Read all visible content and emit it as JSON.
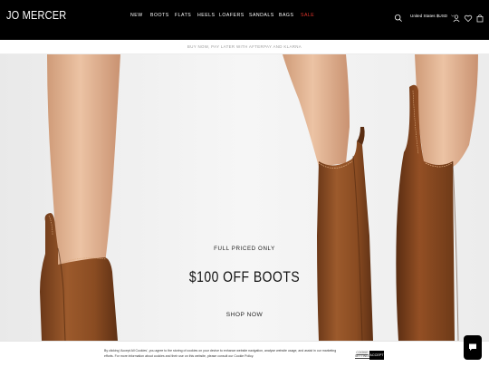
{
  "header": {
    "logo": "JO MERCER",
    "nav": [
      {
        "label": "NEW",
        "sale": false
      },
      {
        "label": "BOOTS",
        "sale": false
      },
      {
        "label": "FLATS",
        "sale": false
      },
      {
        "label": "HEELS",
        "sale": false
      },
      {
        "label": "LOAFERS",
        "sale": false
      },
      {
        "label": "SANDALS",
        "sale": false
      },
      {
        "label": "BAGS",
        "sale": false
      },
      {
        "label": "SALE",
        "sale": true
      }
    ],
    "currency": "United States $USD",
    "icons": [
      "search-icon",
      "chevron-down-icon",
      "account-icon",
      "wishlist-icon",
      "bag-icon"
    ]
  },
  "announcement": "BUY NOW, PAY LATER WITH AFTERPAY AND KLARNA",
  "hero": {
    "eyebrow": "FULL PRICED ONLY",
    "title": "$100 OFF BOOTS",
    "cta": "SHOP NOW"
  },
  "cookie": {
    "text": "By clicking 'Accept All Cookies', you agree to the storing of cookies on your device to enhance website navigation, analyse website usage, and assist in our marketing efforts. For more information about cookies and their use on this website, please consult our Cookie Policy.",
    "preferences": "COOKIE SETTINGS",
    "accept": "ACCEPT"
  },
  "chat": {
    "icon": "chat-icon"
  },
  "colors": {
    "header_bg": "#000000",
    "sale": "#e0342b",
    "boot_leather": "#8a4e26",
    "skin": "#e3b898"
  }
}
